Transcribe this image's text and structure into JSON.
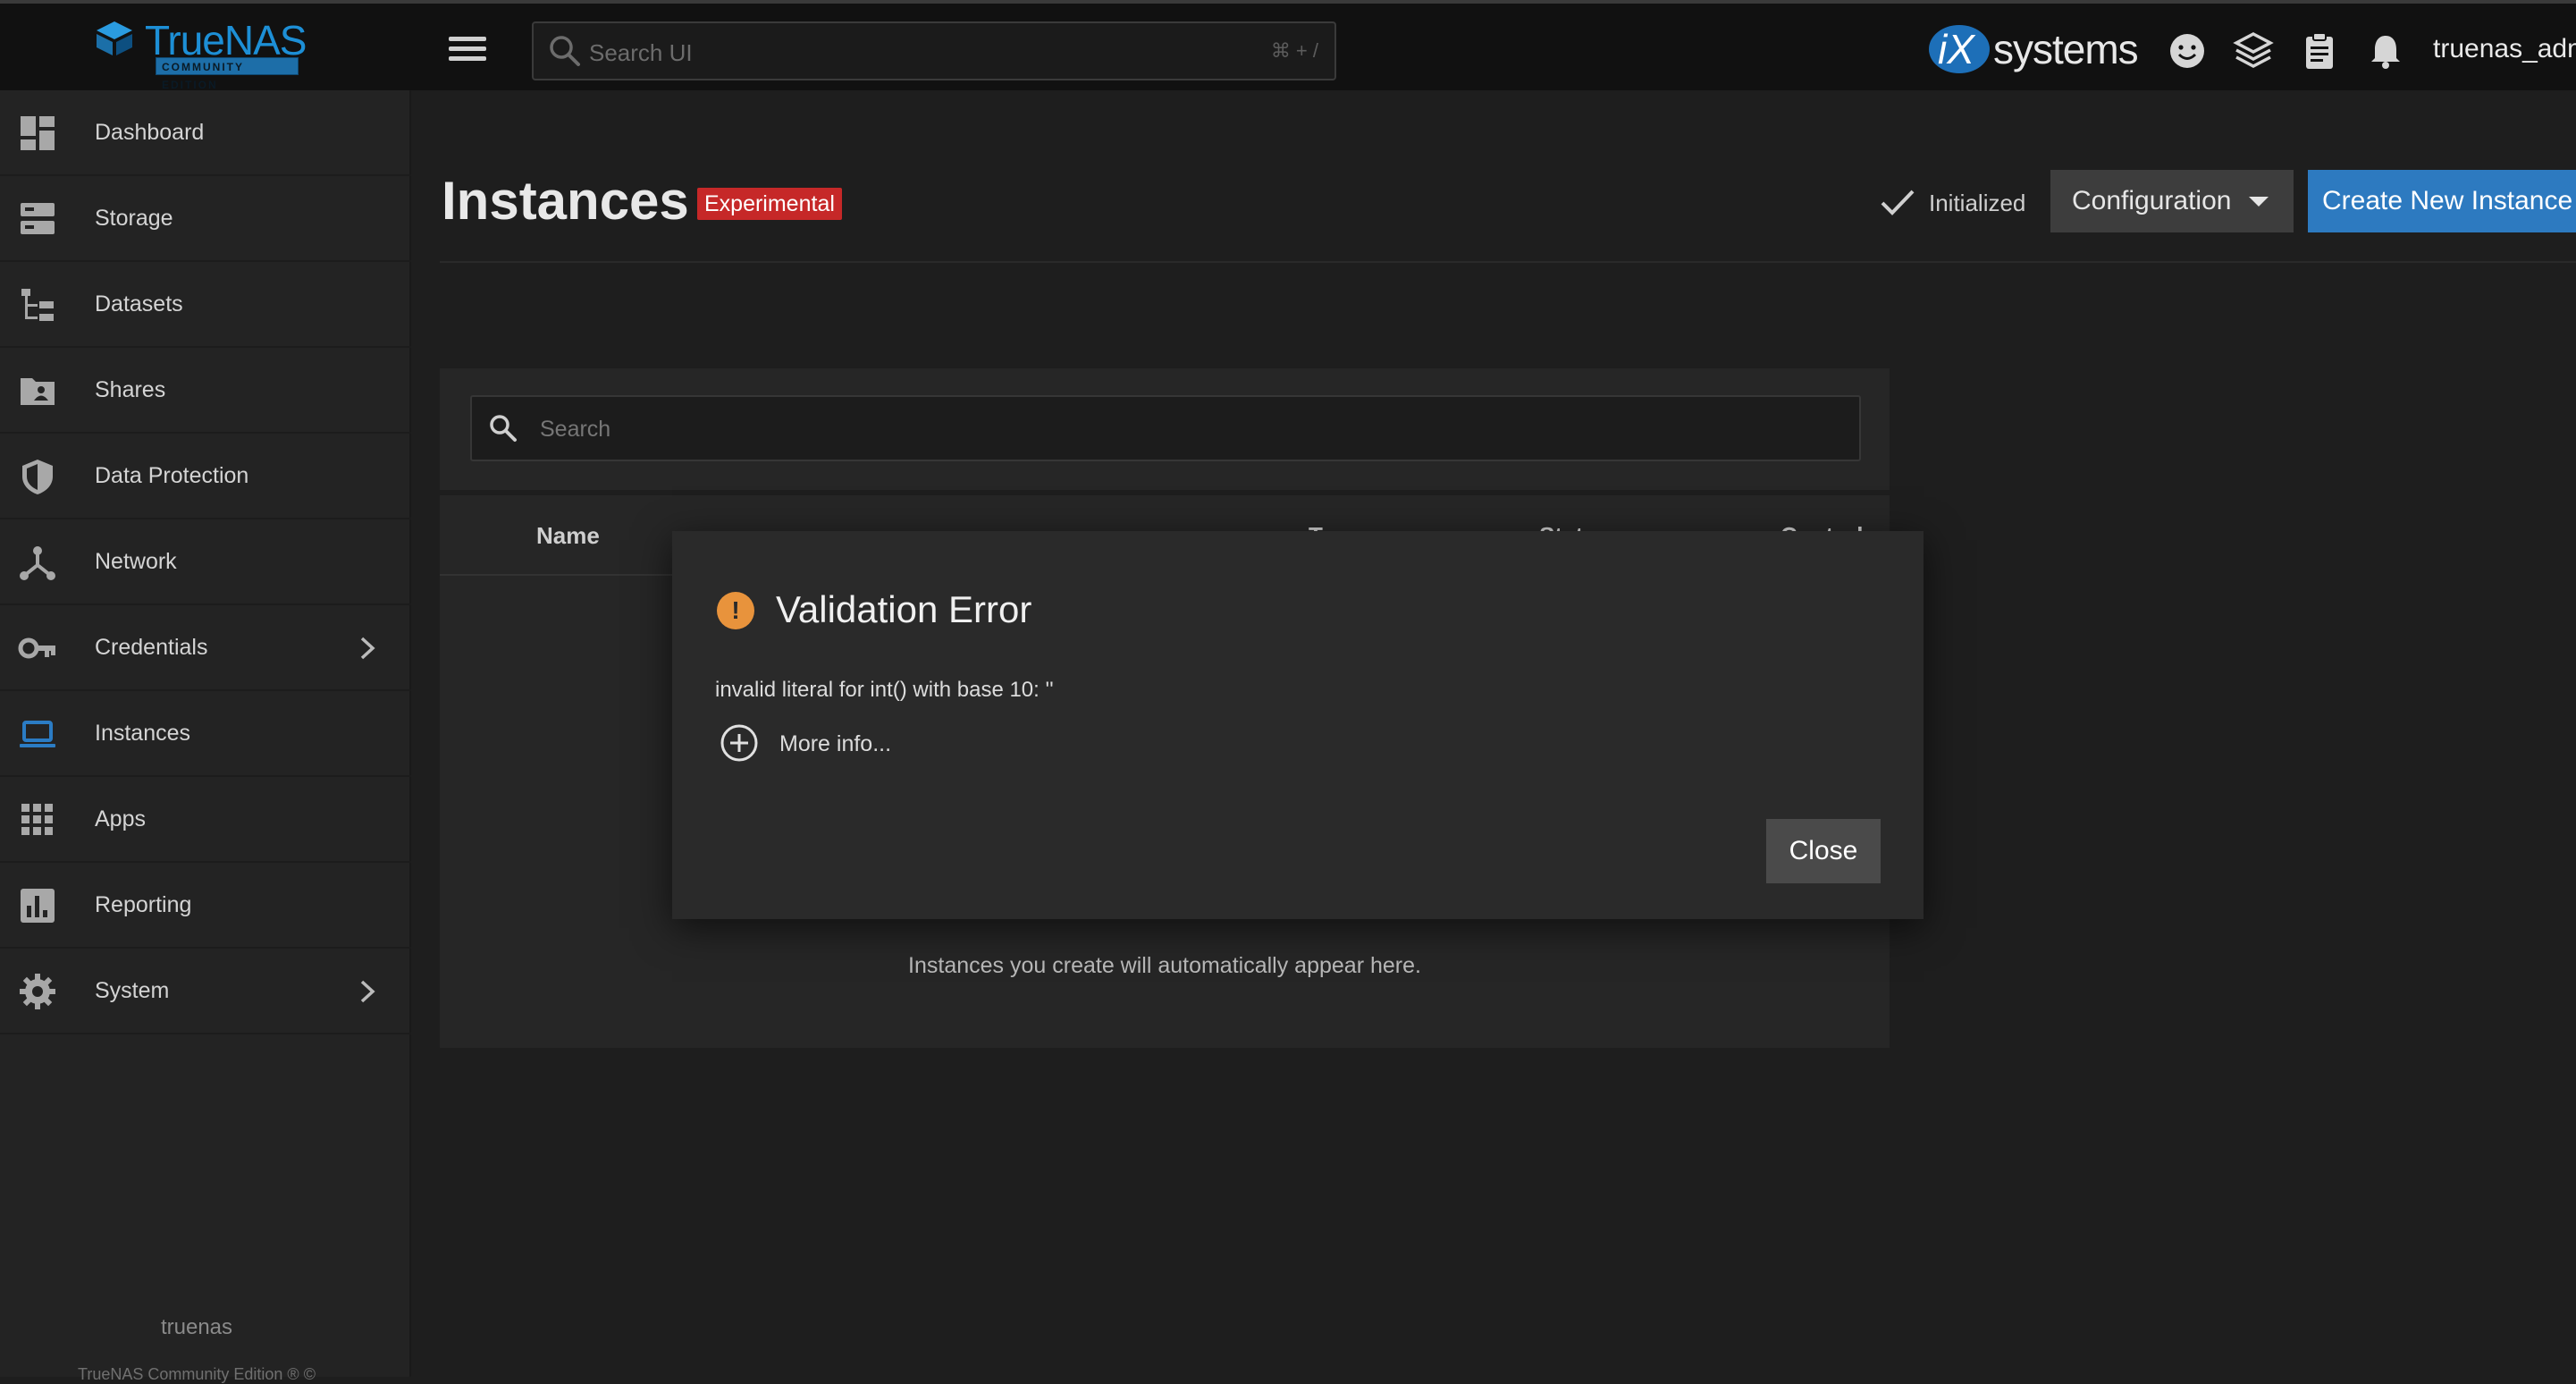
{
  "header": {
    "brand": "TrueNAS",
    "edition": "COMMUNITY EDITION",
    "search_placeholder": "Search UI",
    "search_shortcut": "⌘ + /",
    "partner_logo_ix": "iX",
    "partner_logo_systems": "systems",
    "username": "truenas_adm"
  },
  "sidebar": {
    "items": [
      {
        "label": "Dashboard",
        "icon": "dashboard-icon"
      },
      {
        "label": "Storage",
        "icon": "storage-icon"
      },
      {
        "label": "Datasets",
        "icon": "datasets-icon"
      },
      {
        "label": "Shares",
        "icon": "shares-icon"
      },
      {
        "label": "Data Protection",
        "icon": "shield-icon"
      },
      {
        "label": "Network",
        "icon": "network-icon"
      },
      {
        "label": "Credentials",
        "icon": "key-icon"
      },
      {
        "label": "Instances",
        "icon": "laptop-icon"
      },
      {
        "label": "Apps",
        "icon": "apps-grid-icon"
      },
      {
        "label": "Reporting",
        "icon": "bar-chart-icon"
      },
      {
        "label": "System",
        "icon": "gear-icon"
      }
    ],
    "hostname": "truenas",
    "copyright": "TrueNAS Community Edition ® ©"
  },
  "page": {
    "title": "Instances",
    "badge": "Experimental",
    "status": "Initialized",
    "configuration_label": "Configuration",
    "create_label": "Create New Instance",
    "search_placeholder": "Search",
    "columns": [
      "Name",
      "Type",
      "Status",
      "Controls"
    ],
    "empty_message": "Instances you create will automatically appear here."
  },
  "dialog": {
    "title": "Validation Error",
    "message": "invalid literal for int() with base 10: ''",
    "more_info": "More info...",
    "close_label": "Close"
  },
  "colors": {
    "accent": "#2d7ac0",
    "badge": "#c62828",
    "warning": "#e8933c",
    "active_nav_icon": "#2b7cc4"
  }
}
